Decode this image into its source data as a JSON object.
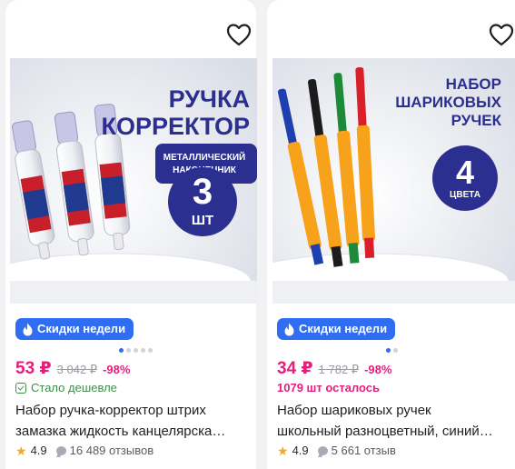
{
  "colors": {
    "accent_blue": "#2f6df3",
    "price_pink": "#e51e7c",
    "green": "#3f8f4a",
    "star": "#f5a623"
  },
  "products": [
    {
      "image": {
        "title_line1": "РУЧКА",
        "title_line2": "КОРРЕКТОР",
        "ribbon_line1": "МЕТАЛЛИЧЕСКИЙ",
        "ribbon_line2": "НАКОНЕЧНИК",
        "circle_big": "3",
        "circle_small": "ШТ"
      },
      "favorite_icon": "heart-outline-icon",
      "badge_label": "Скидки недели",
      "badge_icon": "fire-icon",
      "carousel": {
        "total": 5,
        "active": 1
      },
      "price": "53 ₽",
      "old_price": "3 042 ₽",
      "discount": "-98%",
      "status": "Стало дешевле",
      "title_line1": "Набор ручка-корректор штрих",
      "title_line2": "замазка жидкость канцелярска…",
      "rating": "4.9",
      "reviews": "16 489 отзывов"
    },
    {
      "image": {
        "title_line1": "НАБОР",
        "title_line2": "ШАРИКОВЫХ",
        "title_line3": "РУЧЕК",
        "circle_big": "4",
        "circle_small": "ЦВЕТА"
      },
      "favorite_icon": "heart-outline-icon",
      "badge_label": "Скидки недели",
      "badge_icon": "fire-icon",
      "carousel": {
        "total": 2,
        "active": 1
      },
      "price": "34 ₽",
      "old_price": "1 782 ₽",
      "discount": "-98%",
      "status": "1079 шт осталось",
      "title_line1": "Набор шариковых ручек",
      "title_line2": "школьный разноцветный, синий…",
      "rating": "4.9",
      "reviews": "5 661 отзыв"
    }
  ]
}
